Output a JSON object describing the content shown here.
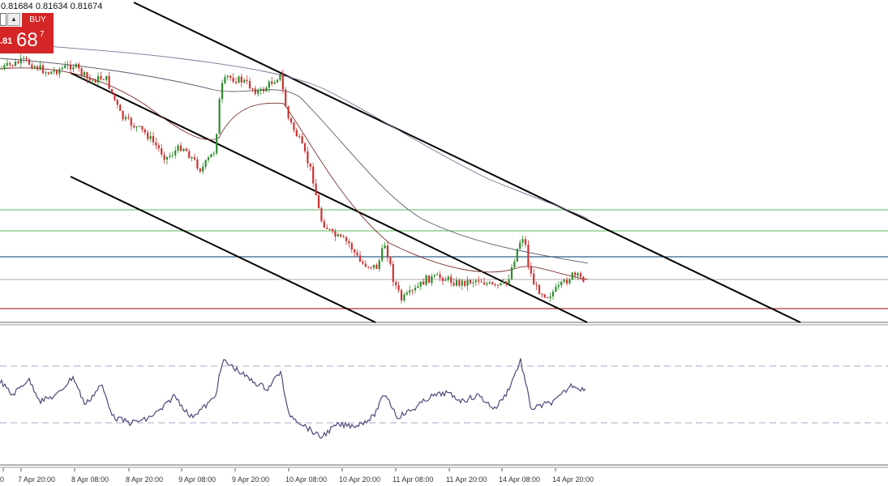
{
  "header": {
    "prices": "0.81684 0.81634 0.81674"
  },
  "trade_panel": {
    "buy_label": "BUY",
    "price_prefix": ".81",
    "price_big": "68",
    "price_sup": "7"
  },
  "x_axis": {
    "labels": [
      "0",
      "7 Apr 20:00",
      "8 Apr 08:00",
      "8 Apr 20:00",
      "9 Apr 08:00",
      "9 Apr 20:00",
      "10 Apr 08:00",
      "10 Apr 20:00",
      "11 Apr 08:00",
      "11 Apr 20:00",
      "14 Apr 08:00",
      "14 Apr 20:00"
    ]
  },
  "colors": {
    "bull": "#2e8b2e",
    "bear": "#cc3333",
    "level_green": "#5cb85c",
    "level_blue": "#2c5f8a",
    "level_gray": "#b5a5a5",
    "level_red": "#b03030",
    "rsi": "#4a4a7a",
    "buy": "#d42626"
  },
  "chart_data": {
    "type": "line",
    "x": [
      "0",
      "7 Apr 20:00",
      "8 Apr 08:00",
      "8 Apr 20:00",
      "9 Apr 08:00",
      "9 Apr 20:00",
      "10 Apr 08:00",
      "10 Apr 20:00",
      "11 Apr 08:00",
      "11 Apr 20:00",
      "14 Apr 08:00",
      "14 Apr 20:00"
    ],
    "series": [
      {
        "values": [
          0.8193,
          0.8196,
          0.819,
          0.8166,
          0.8158,
          0.8191,
          0.819,
          0.8128,
          0.811,
          0.8112,
          0.8128,
          0.8119
        ]
      }
    ],
    "current_price": 0.81674,
    "grid": false
  }
}
